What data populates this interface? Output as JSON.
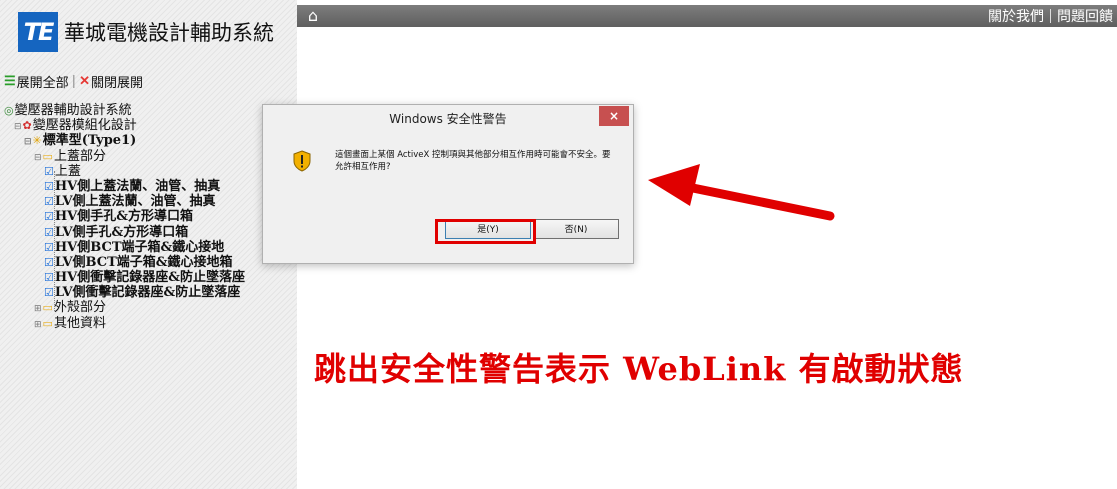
{
  "sidebar": {
    "logo_text": "TE",
    "app_title": "華城電機設計輔助系統",
    "expand_all": "展開全部",
    "collapse_all": "關閉展開",
    "tree": [
      {
        "label": "變壓器輔助設計系統",
        "icon": "globe-icon",
        "indent": 0,
        "bold": false
      },
      {
        "label": "變壓器模組化設計",
        "icon": "gear-icon",
        "indent": 1,
        "bold": false
      },
      {
        "label": "標準型(Type1)",
        "icon": "star-icon",
        "indent": 2,
        "bold": true
      },
      {
        "label": "上蓋部分",
        "icon": "folder-icon",
        "indent": 3,
        "bold": false
      },
      {
        "label": "上蓋",
        "icon": "doc-icon",
        "indent": 4,
        "bold": false
      },
      {
        "label": "HV側上蓋法蘭、油管、抽真",
        "icon": "doc-icon",
        "indent": 4,
        "bold": true
      },
      {
        "label": "LV側上蓋法蘭、油管、抽真",
        "icon": "doc-icon",
        "indent": 4,
        "bold": true
      },
      {
        "label": "HV側手孔&方形導口箱",
        "icon": "doc-icon",
        "indent": 4,
        "bold": true
      },
      {
        "label": "LV側手孔&方形導口箱",
        "icon": "doc-icon",
        "indent": 4,
        "bold": true
      },
      {
        "label": "HV側BCT端子箱&鐵心接地",
        "icon": "doc-icon",
        "indent": 4,
        "bold": true
      },
      {
        "label": "LV側BCT端子箱&鐵心接地箱",
        "icon": "doc-icon",
        "indent": 4,
        "bold": true
      },
      {
        "label": "HV側衝擊記錄器座&防止墜落座",
        "icon": "doc-icon",
        "indent": 4,
        "bold": true
      },
      {
        "label": "LV側衝擊記錄器座&防止墜落座",
        "icon": "doc-icon",
        "indent": 4,
        "bold": true
      },
      {
        "label": "外殼部分",
        "icon": "folder-icon",
        "indent": 3,
        "bold": false
      },
      {
        "label": "其他資料",
        "icon": "folder-icon",
        "indent": 3,
        "bold": false
      }
    ]
  },
  "topbar": {
    "home_icon": "home-icon",
    "about_us": "關於我們",
    "feedback": "問題回饋"
  },
  "dialog": {
    "title": "Windows 安全性警告",
    "close_label": "×",
    "message": "這個畫面上某個 ActiveX 控制項與其他部分相互作用時可能會不安全。要允許相互作用?",
    "yes_label": "是(Y)",
    "no_label": "否(N)"
  },
  "annotation": {
    "text": "跳出安全性警告表示 WebLink 有啟動狀態",
    "color": "#e00000"
  },
  "colors": {
    "logo_blue": "#1565c0",
    "topbar_gray": "#6e6e6e",
    "annotation_red": "#e00000"
  }
}
